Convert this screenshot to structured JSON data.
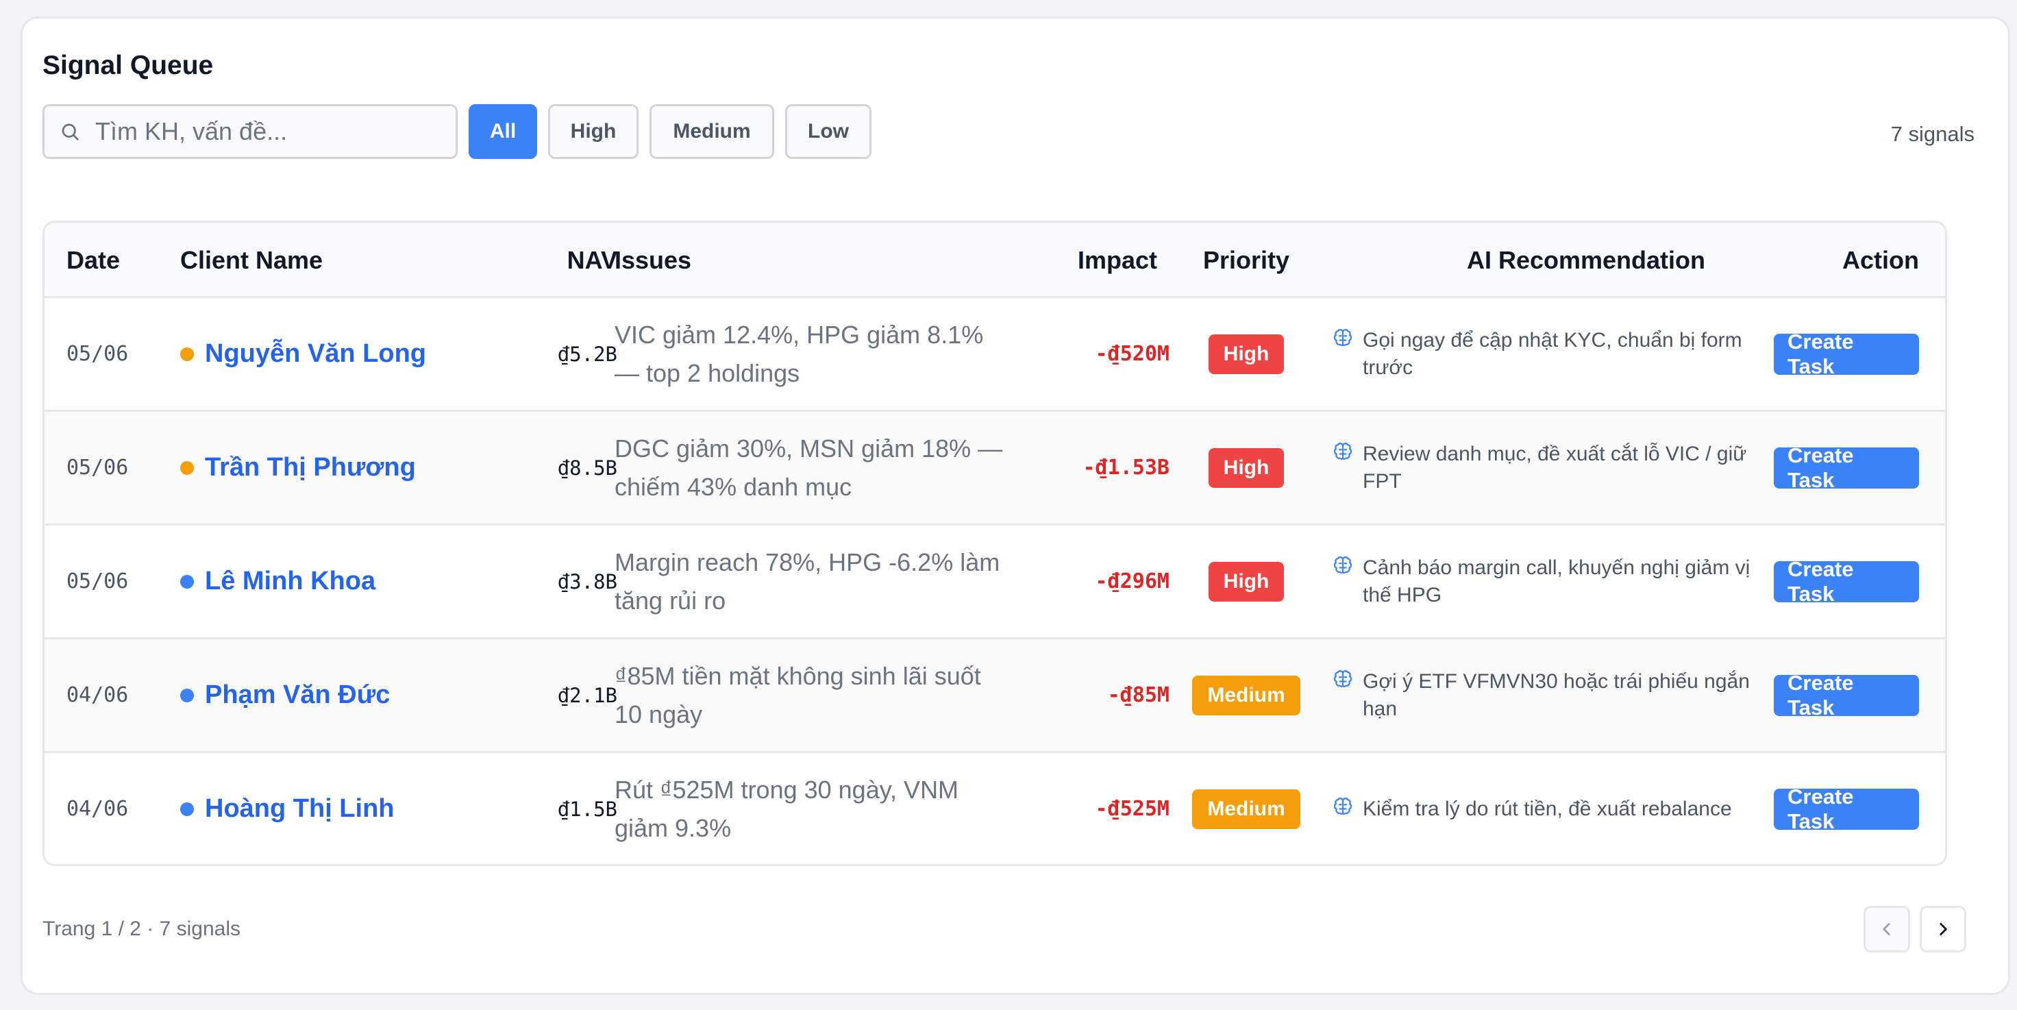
{
  "card": {
    "title": "Signal Queue",
    "search": {
      "placeholder": "Tìm KH, vấn đề..."
    },
    "filters": [
      {
        "label": "All",
        "active": true
      },
      {
        "label": "High",
        "active": false
      },
      {
        "label": "Medium",
        "active": false
      },
      {
        "label": "Low",
        "active": false
      }
    ],
    "signal_count": "7 signals"
  },
  "table": {
    "headers": [
      "Date",
      "Client Name",
      "NAV",
      "Issues",
      "Impact",
      "Priority",
      "AI Recommendation",
      "Action"
    ],
    "rows": [
      {
        "date": "05/06",
        "client": "Nguyễn Văn Long",
        "dot_color": "#f59e0b",
        "nav": "₫5.2B",
        "issues": "VIC giảm 12.4%, HPG giảm 8.1% — top 2 holdings",
        "impact": "-₫520M",
        "priority": "High",
        "priority_color": "#ef4444",
        "ai": "Gọi ngay để cập nhật KYC, chuẩn bị form trước",
        "action": "Create Task"
      },
      {
        "date": "05/06",
        "client": "Trần Thị Phương",
        "dot_color": "#f59e0b",
        "nav": "₫8.5B",
        "issues": "DGC giảm 30%, MSN giảm 18% — chiếm 43% danh mục",
        "impact": "-₫1.53B",
        "priority": "High",
        "priority_color": "#ef4444",
        "ai": "Review danh mục, đề xuất cắt lỗ VIC / giữ FPT",
        "action": "Create Task"
      },
      {
        "date": "05/06",
        "client": "Lê Minh Khoa",
        "dot_color": "#3b82f6",
        "nav": "₫3.8B",
        "issues": "Margin reach 78%, HPG -6.2% làm tăng rủi ro",
        "impact": "-₫296M",
        "priority": "High",
        "priority_color": "#ef4444",
        "ai": "Cảnh báo margin call, khuyến nghị giảm vị thế HPG",
        "action": "Create Task"
      },
      {
        "date": "04/06",
        "client": "Phạm Văn Đức",
        "dot_color": "#3b82f6",
        "nav": "₫2.1B",
        "issues": "₫85M tiền mặt không sinh lãi suốt 10 ngày",
        "impact": "-₫85M",
        "priority": "Medium",
        "priority_color": "#f59e0b",
        "ai": "Gợi ý ETF VFMVN30 hoặc trái phiếu ngắn hạn",
        "action": "Create Task"
      },
      {
        "date": "04/06",
        "client": "Hoàng Thị Linh",
        "dot_color": "#3b82f6",
        "nav": "₫1.5B",
        "issues": "Rút ₫525M trong 30 ngày, VNM giảm 9.3%",
        "impact": "-₫525M",
        "priority": "Medium",
        "priority_color": "#f59e0b",
        "ai": "Kiểm tra lý do rút tiền, đề xuất rebalance",
        "action": "Create Task"
      }
    ]
  },
  "footer": {
    "page_info": "Trang 1 / 2 · 7 signals"
  },
  "icons": {
    "search": "search-icon",
    "ai": "brain-icon",
    "prev": "chevron-left-icon",
    "next": "chevron-right-icon"
  }
}
